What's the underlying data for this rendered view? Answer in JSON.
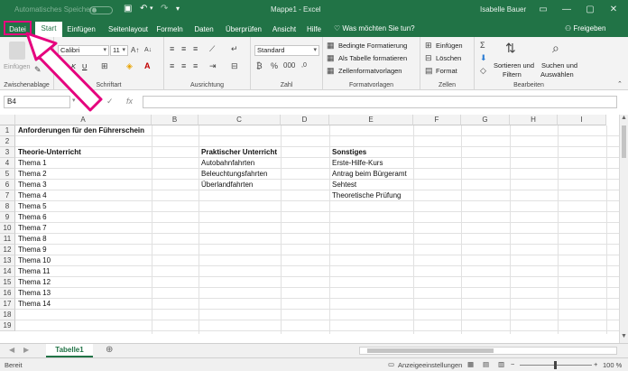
{
  "titlebar": {
    "autosave": "Automatisches Speichern",
    "document": "Mappe1 - Excel",
    "user": "Isabelle Bauer"
  },
  "tabs": [
    "Datei",
    "Start",
    "Einfügen",
    "Seitenlayout",
    "Formeln",
    "Daten",
    "Überprüfen",
    "Ansicht",
    "Hilfe"
  ],
  "tell_me": "Was möchten Sie tun?",
  "share": "Freigeben",
  "ribbon": {
    "clipboard": {
      "paste": "Einfügen",
      "label": "Zwischenablage"
    },
    "font": {
      "name": "Calibri",
      "size": "11",
      "label": "Schriftart",
      "bold": "F",
      "italic": "K",
      "underline": "U"
    },
    "alignment": {
      "label": "Ausrichtung"
    },
    "number": {
      "format": "Standard",
      "label": "Zahl"
    },
    "styles": {
      "conditional": "Bedingte Formatierung",
      "table": "Als Tabelle formatieren",
      "cell": "Zellenformatvorlagen",
      "label": "Formatvorlagen"
    },
    "cells": {
      "insert": "Einfügen",
      "delete": "Löschen",
      "format": "Format",
      "label": "Zellen"
    },
    "editing": {
      "sort1": "Sortieren und",
      "sort2": "Filtern",
      "find1": "Suchen und",
      "find2": "Auswählen",
      "label": "Bearbeiten"
    }
  },
  "formula_bar": {
    "cell_ref": "B4",
    "value": ""
  },
  "columns": [
    "A",
    "B",
    "C",
    "D",
    "E",
    "F",
    "G",
    "H",
    "I"
  ],
  "rows": [
    "1",
    "2",
    "3",
    "4",
    "5",
    "6",
    "7",
    "8",
    "9",
    "10",
    "11",
    "12",
    "13",
    "14",
    "15",
    "16",
    "17",
    "18",
    "19"
  ],
  "cells": {
    "A1": "Anforderungen für den Führerschein",
    "A3": "Theorie-Unterricht",
    "C3": "Praktischer Unterricht",
    "E3": "Sonstiges",
    "A4": "Thema 1",
    "A5": "Thema 2",
    "A6": "Thema 3",
    "A7": "Thema 4",
    "A8": "Thema 5",
    "A9": "Thema 6",
    "A10": "Thema 7",
    "A11": "Thema 8",
    "A12": "Thema 9",
    "A13": "Thema 10",
    "A14": "Thema 11",
    "A15": "Thema 12",
    "A16": "Thema 13",
    "A17": "Thema 14",
    "C4": "Autobahnfahrten",
    "C5": "Beleuchtungsfahrten",
    "C6": "Überlandfahrten",
    "E4": "Erste-Hilfe-Kurs",
    "E5": "Antrag beim Bürgeramt",
    "E6": "Sehtest",
    "E7": "Theoretische Prüfung"
  },
  "sheet_tab": "Tabelle1",
  "status": {
    "ready": "Bereit",
    "display": "Anzeigeeinstellungen",
    "zoom": "100 %"
  },
  "colors": {
    "accent": "#217346",
    "highlight": "#e5007d"
  }
}
